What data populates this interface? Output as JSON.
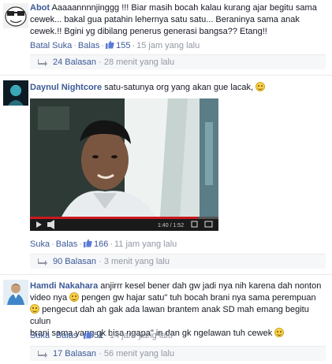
{
  "comments": [
    {
      "author": "Abot",
      "avatar": "meme-face-avatar",
      "text_lines": [
        "Aaaaannnnjinggg !!! Biar masih bocah kalau kurang ajar begitu sama",
        "cewek... bakal gua patahin lehernya satu satu... Beraninya sama anak",
        "cewek.!! Bgini yg dibilang penerus generasi bangsa?? Etang!!"
      ],
      "actions": {
        "like": "Batal Suka",
        "reply": "Balas",
        "likes": "155",
        "time": "15 jam yang lalu"
      },
      "replies": {
        "count": "24 Balasan",
        "ago": "28 menit yang lalu"
      }
    },
    {
      "author": "Daynul Nightcore",
      "avatar": "anime-avatar",
      "text": "satu-satunya org yang akan gue lacak,",
      "video": {
        "time": "1:40 / 1:52",
        "progress": 0.89
      },
      "actions": {
        "like": "Suka",
        "reply": "Balas",
        "likes": "166",
        "time": "11 jam yang lalu"
      },
      "replies": {
        "count": "90 Balasan",
        "ago": "3 menit yang lalu"
      }
    },
    {
      "author": "Hamdi Nakahara",
      "avatar": "person-avatar",
      "text_lines": [
        "anjirrr kesel bener dah gw jadi nya nih karena dah nonton",
        "video nya",
        "pengen gw hajar satu\" tuh bocah brani nya sama perempuan",
        "pengecut dah ah gak ada lawan brantem anak SD mah emang begitu culun",
        "brani sama yang gk bisa ngapa\" in dan gk ngelawan tuh cewek"
      ],
      "actions": {
        "like": "Suka",
        "reply": "Balas",
        "likes": "51",
        "time": "14 jam yang lalu"
      },
      "replies": {
        "count": "17 Balasan",
        "ago": "56 menit yang lalu"
      }
    }
  ],
  "colors": {
    "link": "#3b5998",
    "meta": "#9197a3",
    "reply_bg": "#f6f7f9"
  }
}
